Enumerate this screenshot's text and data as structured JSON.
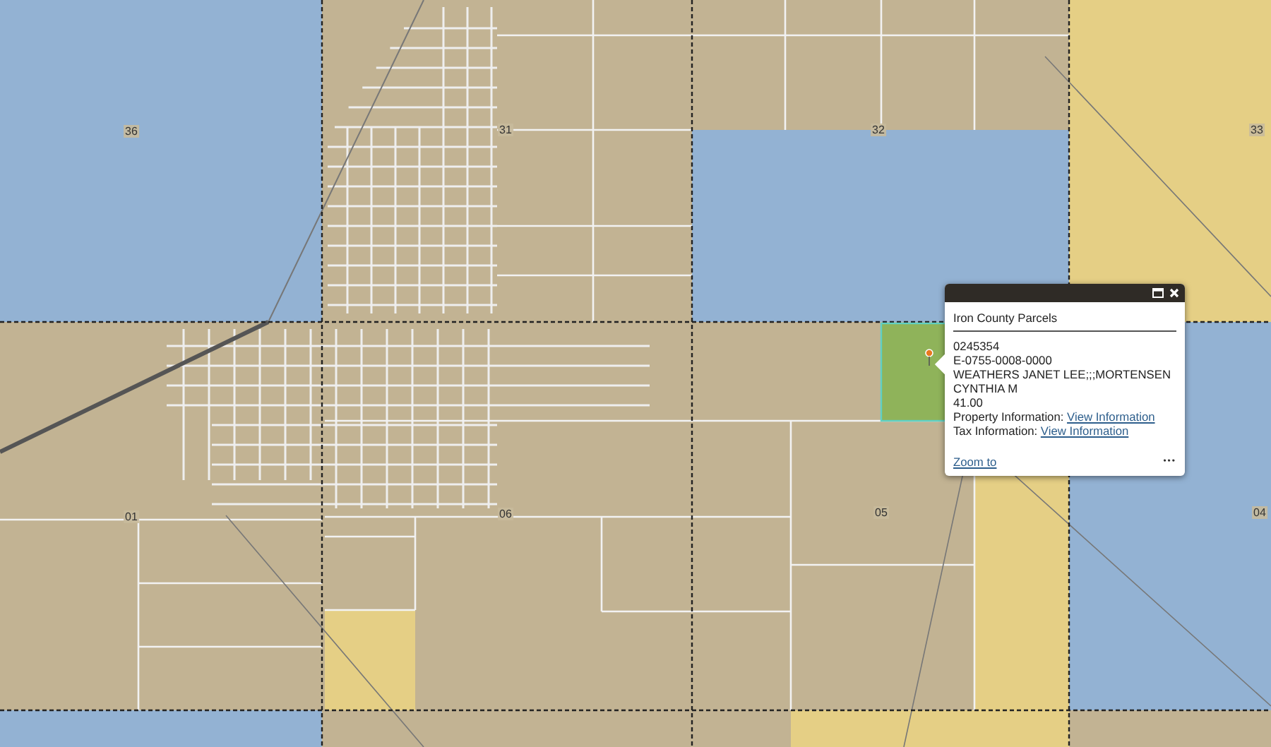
{
  "map": {
    "section_labels": [
      "36",
      "31",
      "32",
      "33",
      "01",
      "06",
      "05",
      "04"
    ]
  },
  "popup": {
    "title": "Iron County Parcels",
    "lines": [
      "0245354",
      "E-0755-0008-0000",
      "WEATHERS JANET LEE;;;MORTENSEN CYNTHIA M",
      "41.00"
    ],
    "links": [
      {
        "label": "Property Information:",
        "link": "View Information"
      },
      {
        "label": "Tax Information:",
        "link": "View Information"
      }
    ],
    "zoom_link": "Zoom to",
    "more": "•••"
  }
}
